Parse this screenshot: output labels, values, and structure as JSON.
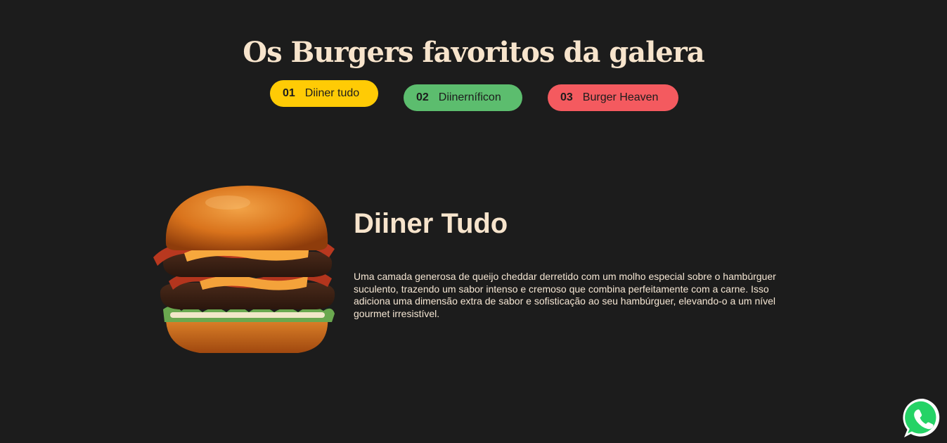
{
  "header": {
    "title": "Os Burgers favoritos da galera"
  },
  "tabs": [
    {
      "number": "01",
      "label": "Diiner tudo",
      "color": "#ffcb05"
    },
    {
      "number": "02",
      "label": "Diinerníficon",
      "color": "#5cbd6e"
    },
    {
      "number": "03",
      "label": "Burger Heaven",
      "color": "#f45a5f"
    }
  ],
  "featured": {
    "image_icon": "burger-image",
    "title": "Diiner Tudo",
    "description": "Uma camada generosa de queijo cheddar derretido com um molho especial sobre o hambúrguer suculento, trazendo um sabor intenso e cremoso que combina perfeitamente com a carne. Isso adiciona uma dimensão extra de sabor e sofisticação ao seu hambúrguer, elevando-o a um nível gourmet irresistível."
  },
  "floating": {
    "icon": "whatsapp-icon",
    "color": "#25d366"
  },
  "theme": {
    "background": "#1c1c1c",
    "text": "#f7e4cc"
  }
}
